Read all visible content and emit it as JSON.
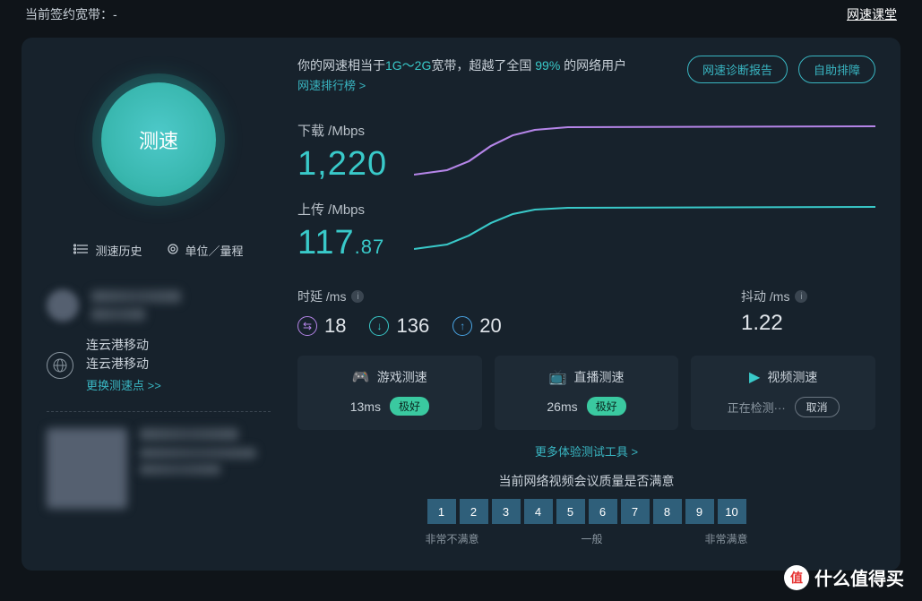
{
  "topbar": {
    "contract_label": "当前签约宽带：",
    "contract_value": "-",
    "classroom_link": "网速课堂"
  },
  "left": {
    "speed_button": "测速",
    "history_link": "测速历史",
    "units_link": "单位／量程",
    "isp_line1": "连云港移动",
    "isp_line2": "连云港移动",
    "change_node": "更换测速点 >>"
  },
  "summary": {
    "prefix": "你的网速相当于",
    "band": "1G～2G",
    "mid": "宽带，超越了全国 ",
    "pct": "99%",
    "suffix": " 的网络用户",
    "rank_link": "网速排行榜 >",
    "diag_btn": "网速诊断报告",
    "self_btn": "自助排障"
  },
  "speeds": {
    "download_label": "下载 /Mbps",
    "download_value": "1,220",
    "upload_label": "上传 /Mbps",
    "upload_int": "117",
    "upload_dec": ".87"
  },
  "latency": {
    "title": "时延 /ms",
    "ping": "18",
    "down": "136",
    "up": "20",
    "jitter_title": "抖动 /ms",
    "jitter_value": "1.22"
  },
  "cards": {
    "game_title": "游戏测速",
    "game_value": "13ms",
    "game_badge": "极好",
    "live_title": "直播测速",
    "live_value": "26ms",
    "live_badge": "极好",
    "video_title": "视频测速",
    "video_status": "正在检测···",
    "video_cancel": "取消"
  },
  "footer": {
    "more_tools": "更多体验测试工具 >",
    "survey_q": "当前网络视频会议质量是否满意",
    "ratings": [
      "1",
      "2",
      "3",
      "4",
      "5",
      "6",
      "7",
      "8",
      "9",
      "10"
    ],
    "label_low": "非常不满意",
    "label_mid": "一般",
    "label_high": "非常满意"
  },
  "watermark": "什么值得买",
  "watermark_badge": "值",
  "chart_data": [
    {
      "type": "line",
      "title": "下载 /Mbps",
      "x": [
        0,
        1,
        2,
        3,
        4,
        5,
        6,
        7,
        8,
        9,
        10,
        11,
        12,
        13,
        14,
        15,
        16,
        17,
        18,
        19
      ],
      "values": [
        200,
        300,
        500,
        800,
        1050,
        1150,
        1200,
        1210,
        1215,
        1218,
        1220,
        1220,
        1220,
        1220,
        1220,
        1220,
        1220,
        1220,
        1220,
        1220
      ],
      "ylim": [
        0,
        1300
      ]
    },
    {
      "type": "line",
      "title": "上传 /Mbps",
      "x": [
        0,
        1,
        2,
        3,
        4,
        5,
        6,
        7,
        8,
        9,
        10,
        11,
        12,
        13,
        14,
        15,
        16,
        17,
        18,
        19
      ],
      "values": [
        30,
        40,
        60,
        85,
        100,
        110,
        115,
        117,
        117,
        117.5,
        117.8,
        117.87,
        117.87,
        117.87,
        117.87,
        117.87,
        117.87,
        117.87,
        117.87,
        117.87
      ],
      "ylim": [
        0,
        130
      ]
    }
  ]
}
